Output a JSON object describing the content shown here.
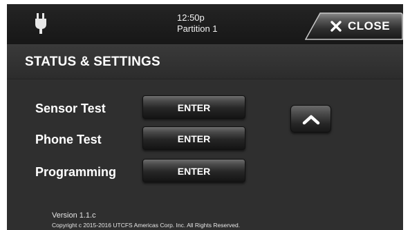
{
  "header": {
    "time": "12:50p",
    "partition": "Partition 1",
    "power_icon": "plug-icon",
    "close_label": "CLOSE",
    "close_icon": "close-icon"
  },
  "page": {
    "title": "STATUS & SETTINGS"
  },
  "menu": {
    "items": [
      {
        "label": "Sensor Test",
        "button": "ENTER"
      },
      {
        "label": "Phone Test",
        "button": "ENTER"
      },
      {
        "label": "Programming",
        "button": "ENTER"
      }
    ],
    "scroll_up_icon": "chevron-up-icon"
  },
  "footer": {
    "version": "Version 1.1.c",
    "copyright": "Copyright   c 2015-2016   UTCFS  Americas  Corp.  Inc.  All  Rights  Reserved."
  },
  "colors": {
    "background": "#2f2f2f",
    "header_background": "#1c1c1c",
    "text": "#ffffff"
  }
}
